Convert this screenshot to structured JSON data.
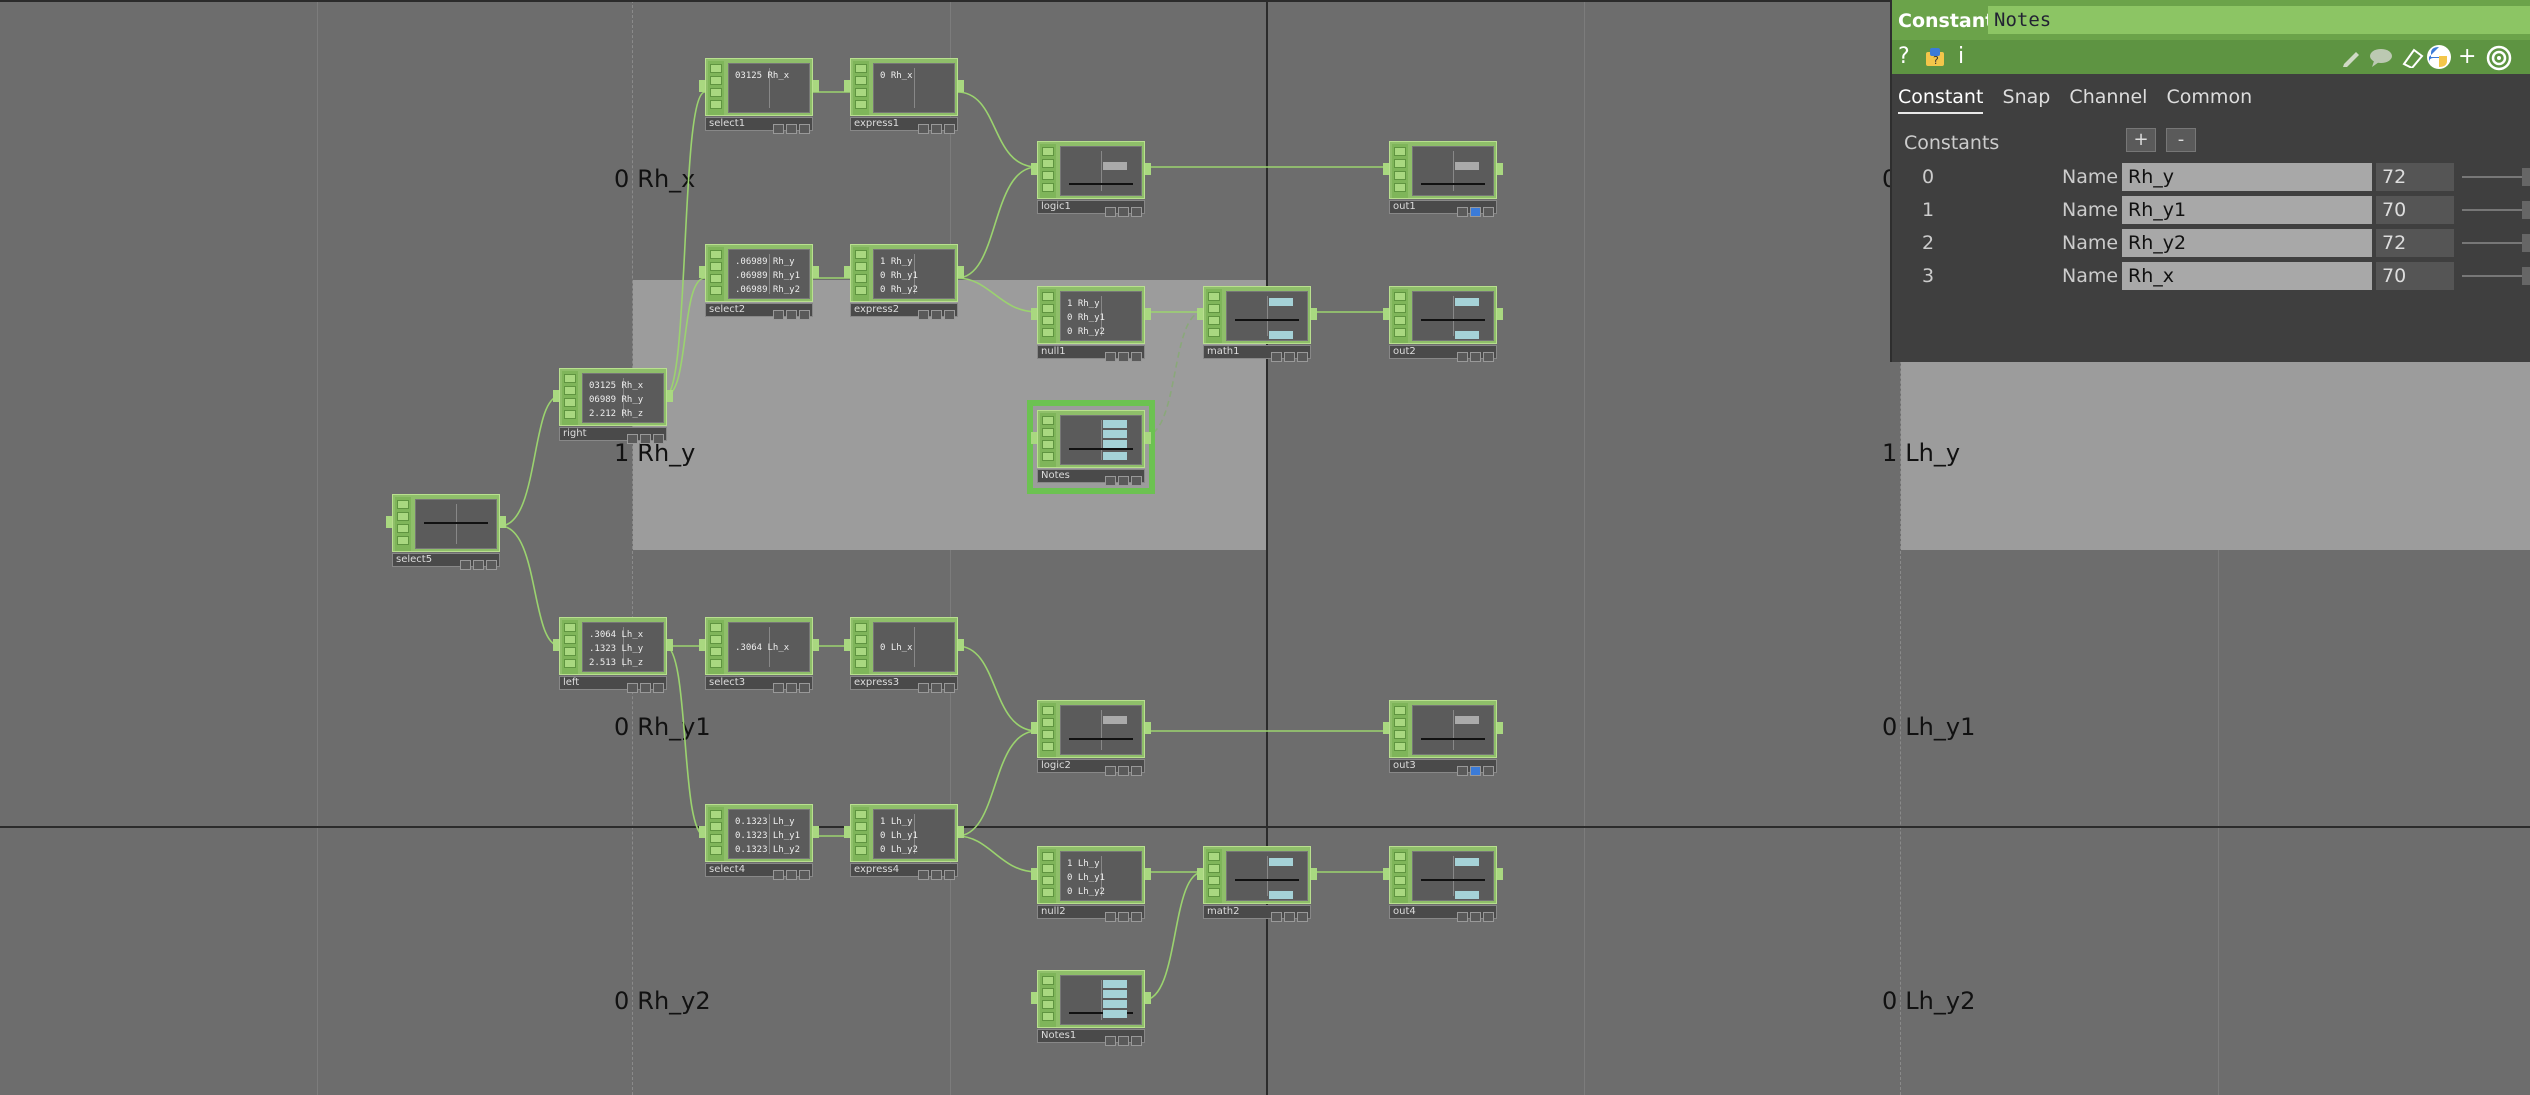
{
  "network": {
    "row_labels": [
      {
        "index": "0",
        "name": "Rh_x"
      },
      {
        "index": "1",
        "name": "Rh_y"
      },
      {
        "index": "0",
        "name": "Rh_y1"
      },
      {
        "index": "0",
        "name": "Rh_y2"
      },
      {
        "index": "1",
        "name": "Lh_y"
      },
      {
        "index": "0",
        "name": "Lh_y1"
      },
      {
        "index": "0",
        "name": "Lh_y2"
      },
      {
        "index": "0",
        "name": ""
      }
    ],
    "nodes": {
      "select1": {
        "name": "select1",
        "text": "03125 Rh_x"
      },
      "express1": {
        "name": "express1",
        "text": "0 Rh_x"
      },
      "select2": {
        "name": "select2",
        "text": ".06989 Rh_y\n.06989 Rh_y1\n.06989 Rh_y2"
      },
      "express2": {
        "name": "express2",
        "text": "1 Rh_y\n0 Rh_y1\n0 Rh_y2"
      },
      "logic1": {
        "name": "logic1",
        "text": ""
      },
      "out1": {
        "name": "out1",
        "text": ""
      },
      "null1": {
        "name": "null1",
        "text": "1 Rh_y\n0 Rh_y1\n0 Rh_y2"
      },
      "math1": {
        "name": "math1",
        "text": ""
      },
      "out2": {
        "name": "out2",
        "text": ""
      },
      "right": {
        "name": "right",
        "text": "03125 Rh_x\n06989 Rh_y\n2.212 Rh_z"
      },
      "notes": {
        "name": "Notes",
        "text": ""
      },
      "select5": {
        "name": "select5",
        "text": ""
      },
      "left": {
        "name": "left",
        "text": ".3064 Lh_x\n.1323 Lh_y\n2.513 Lh_z"
      },
      "select3": {
        "name": "select3",
        "text": ".3064 Lh_x"
      },
      "express3": {
        "name": "express3",
        "text": "0 Lh_x"
      },
      "logic2": {
        "name": "logic2",
        "text": ""
      },
      "out3": {
        "name": "out3",
        "text": ""
      },
      "select4": {
        "name": "select4",
        "text": "0.1323 Lh_y\n0.1323 Lh_y1\n0.1323 Lh_y2"
      },
      "express4": {
        "name": "express4",
        "text": "1 Lh_y\n0 Lh_y1\n0 Lh_y2"
      },
      "null2": {
        "name": "null2",
        "text": "1 Lh_y\n0 Lh_y1\n0 Lh_y2"
      },
      "math2": {
        "name": "math2",
        "text": ""
      },
      "out4": {
        "name": "out4",
        "text": ""
      },
      "notes1": {
        "name": "Notes1",
        "text": ""
      }
    }
  },
  "panel": {
    "op_type": "Constant",
    "op_name": "Notes",
    "toolbar_icons": [
      "help-icon",
      "python-help-icon",
      "info-icon",
      "edit-icon",
      "comment-icon",
      "copy-icon",
      "python-icon",
      "add-icon",
      "target-icon"
    ],
    "toolbar_glyphs": {
      "help": "?",
      "info": "i",
      "add": "+"
    },
    "tabs": [
      "Constant",
      "Snap",
      "Channel",
      "Common"
    ],
    "section_label": "Constants",
    "plus_label": "+",
    "minus_label": "-",
    "name_label": "Name",
    "constants": [
      {
        "index": "0",
        "name": "Rh_y",
        "value": "72"
      },
      {
        "index": "1",
        "name": "Rh_y1",
        "value": "70"
      },
      {
        "index": "2",
        "name": "Rh_y2",
        "value": "72"
      },
      {
        "index": "3",
        "name": "Rh_x",
        "value": "70"
      }
    ],
    "accent_color": "#6ba34a"
  }
}
